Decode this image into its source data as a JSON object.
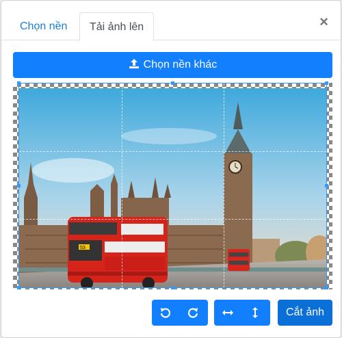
{
  "tabs": [
    {
      "label": "Chọn nền"
    },
    {
      "label": "Tải ảnh lên"
    }
  ],
  "close_label": "×",
  "upload_button_label": "Chọn nền khác",
  "image": {
    "bus_number": "53"
  },
  "toolbar": {
    "rotate_left_icon": "rotate-left-icon",
    "rotate_right_icon": "rotate-right-icon",
    "flip_horizontal_icon": "flip-horizontal-icon",
    "flip_vertical_icon": "flip-vertical-icon",
    "crop_label": "Cắt ảnh"
  },
  "colors": {
    "primary": "#127fff",
    "crop_border": "#3399ff"
  }
}
